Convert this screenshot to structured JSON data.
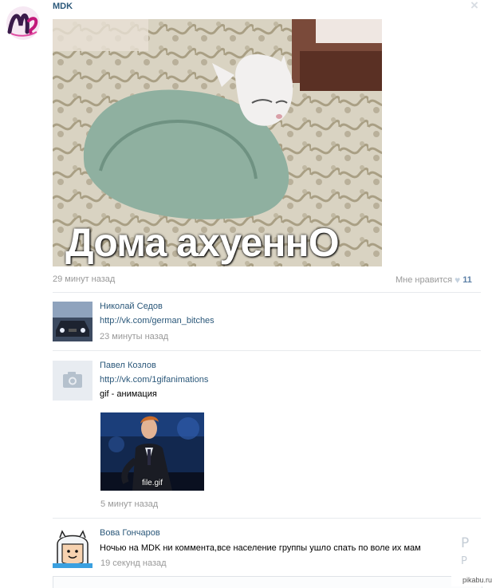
{
  "post": {
    "author": "MDK",
    "image_caption": "Дома ахуеннО",
    "time": "29 минут назад",
    "like_label": "Мне нравится",
    "like_count": "11"
  },
  "comments": [
    {
      "name": "Николай Седов",
      "link": "http://vk.com/german_bitches",
      "time": "23 минуты назад"
    },
    {
      "name": "Павел Козлов",
      "link": "http://vk.com/1gifanimations",
      "text": "gif - анимация",
      "attachment_label": "file.gif",
      "time": "5 минут назад"
    },
    {
      "name": "Вова Гончаров",
      "text": "Ночью на MDK ни коммента,все население группы ушло спать по воле их мам",
      "time": "19 секунд назад"
    }
  ],
  "side_letters": [
    "Р",
    "Р"
  ],
  "watermark": "pikabu.ru",
  "colors": {
    "link": "#2b587a",
    "muted": "#999999",
    "like": "#5b7fa6"
  }
}
